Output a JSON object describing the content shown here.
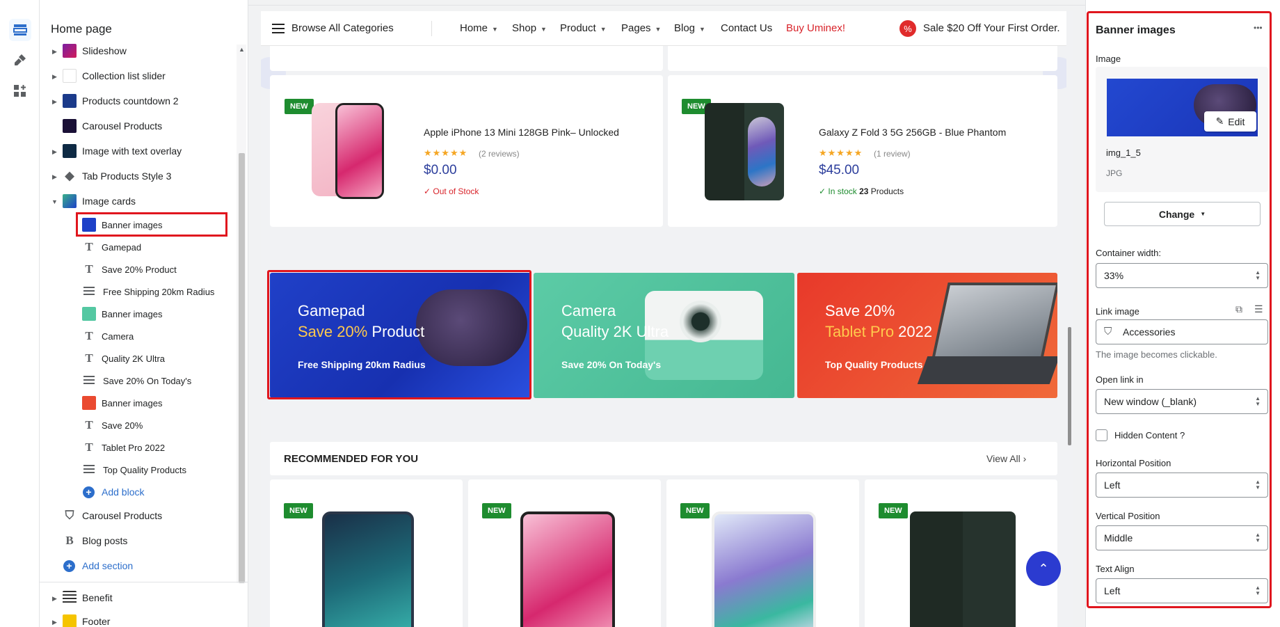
{
  "sidebar": {
    "title": "Home page",
    "tree": [
      {
        "label": "Slideshow"
      },
      {
        "label": "Collection list slider"
      },
      {
        "label": "Products countdown 2"
      },
      {
        "label": "Carousel Products"
      },
      {
        "label": "Image with text overlay"
      },
      {
        "label": "Tab Products Style 3"
      },
      {
        "label": "Image cards"
      },
      {
        "label": "Banner images"
      },
      {
        "label": "Gamepad"
      },
      {
        "label": "Save 20% Product"
      },
      {
        "label": "Free Shipping 20km Radius"
      },
      {
        "label": "Banner images"
      },
      {
        "label": "Camera"
      },
      {
        "label": "Quality 2K Ultra"
      },
      {
        "label": "Save 20% On Today's"
      },
      {
        "label": "Banner images"
      },
      {
        "label": "Save 20%"
      },
      {
        "label": "Tablet Pro 2022"
      },
      {
        "label": "Top Quality Products"
      },
      {
        "label": "Add block"
      },
      {
        "label": "Carousel Products"
      },
      {
        "label": "Blog posts"
      },
      {
        "label": "Add section"
      },
      {
        "label": "Benefit"
      },
      {
        "label": "Footer"
      }
    ]
  },
  "store": {
    "nav": {
      "browse": "Browse All Categories",
      "items": [
        "Home",
        "Shop",
        "Product",
        "Pages",
        "Blog"
      ],
      "contact": "Contact Us",
      "buy": "Buy Uminex!",
      "sale": "Sale $20 Off Your First Order."
    },
    "products": [
      {
        "badge": "NEW",
        "title": "Apple iPhone 13 Mini 128GB Pink– Unlocked",
        "stars": "★★★★★",
        "reviews": "(2 reviews)",
        "price": "$0.00",
        "stock": "✓ Out of Stock",
        "count": "",
        "count_suffix": ""
      },
      {
        "badge": "NEW",
        "title": "Galaxy Z Fold 3 5G 256GB - Blue Phantom",
        "stars": "★★★★★",
        "reviews": "(1 review)",
        "price": "$45.00",
        "stock": "✓ In stock",
        "count": "23",
        "count_suffix": " Products"
      }
    ],
    "banners": [
      {
        "line1": "Gamepad",
        "line2_hl": "Save 20%",
        "line2_rest": " Product",
        "line3": "Free Shipping 20km Radius",
        "color": "#1d40c8"
      },
      {
        "line1": "Camera",
        "line2_hl": "",
        "line2_rest": "Quality 2K Ultra",
        "line3": "Save 20% On Today's",
        "color": "#54c8a2"
      },
      {
        "line1": "Save 20%",
        "line2_hl": "Tablet Pro",
        "line2_rest": " 2022",
        "line3": "Top Quality Products",
        "color": "#ea4a30"
      }
    ],
    "recommended": {
      "title": "RECOMMENDED FOR YOU",
      "view_all": "View All"
    },
    "rec_badges": [
      "NEW",
      "NEW",
      "NEW",
      "NEW"
    ]
  },
  "settings": {
    "title": "Banner images",
    "more": "•••",
    "image_label": "Image",
    "edit": "Edit",
    "file_name": "img_1_5",
    "file_type": "JPG",
    "change": "Change",
    "container_width_label": "Container width:",
    "container_width": "33%",
    "link_label": "Link image",
    "link_value": "Accessories",
    "link_help": "The image becomes clickable.",
    "open_label": "Open link in",
    "open_value": "New window (_blank)",
    "hidden_label": "Hidden Content ?",
    "hpos_label": "Horizontal Position",
    "hpos": "Left",
    "vpos_label": "Vertical Position",
    "vpos": "Middle",
    "align_label": "Text Align",
    "align": "Left"
  }
}
